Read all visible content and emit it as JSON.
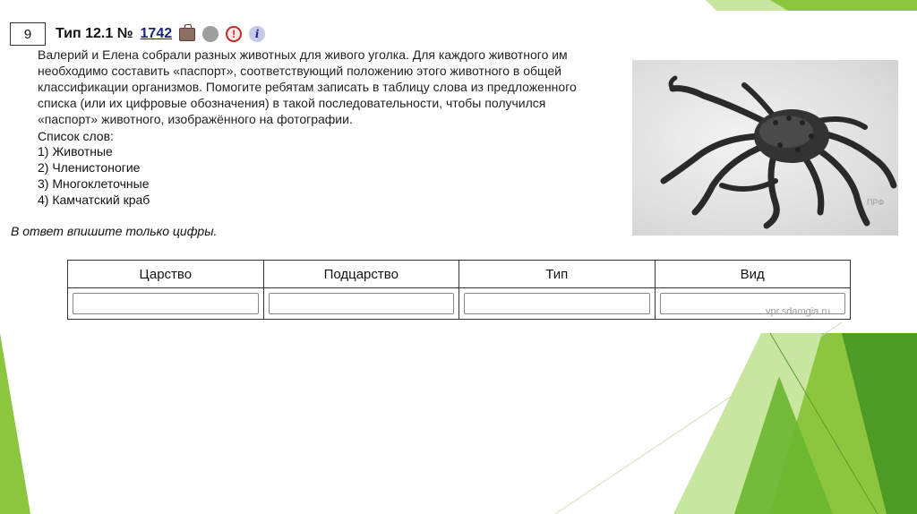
{
  "task": {
    "number": "9",
    "type_label": "Тип 12.1 №",
    "task_id": "1742",
    "icons": [
      "briefcase-icon",
      "gray-circle-icon",
      "alert-icon",
      "info-icon"
    ],
    "icon_glyphs": {
      "alert": "!",
      "info": "i"
    },
    "text": "Валерий и Елена собрали разных животных для живого уголка. Для каждого животного им необходимо составить «паспорт», соответствующий положению этого животного в общей классификации организмов. Помогите ребятам записать в таблицу слова из предложенного списка (или их цифровые обозначения) в такой последовательности, чтобы получился «паспорт» животного, изображённого на фотографии.",
    "list_title": "Список слов:",
    "words": [
      "1) Животные",
      "2) Членистоногие",
      "3) Многоклеточные",
      "4) Камчатский краб"
    ],
    "answer_note": "В ответ впишите только цифры."
  },
  "photo": {
    "watermark": "ПРФ"
  },
  "table": {
    "headers": [
      "Царство",
      "Подцарство",
      "Тип",
      "Вид"
    ],
    "inputs": [
      "",
      "",
      "",
      ""
    ]
  },
  "site_mark": "vpr.sdamgia.ru",
  "colors": {
    "accent_green": "#8cc63f",
    "dark_green": "#4e9a26",
    "light_green": "#c8e6a0",
    "link_blue": "#1a237e"
  }
}
